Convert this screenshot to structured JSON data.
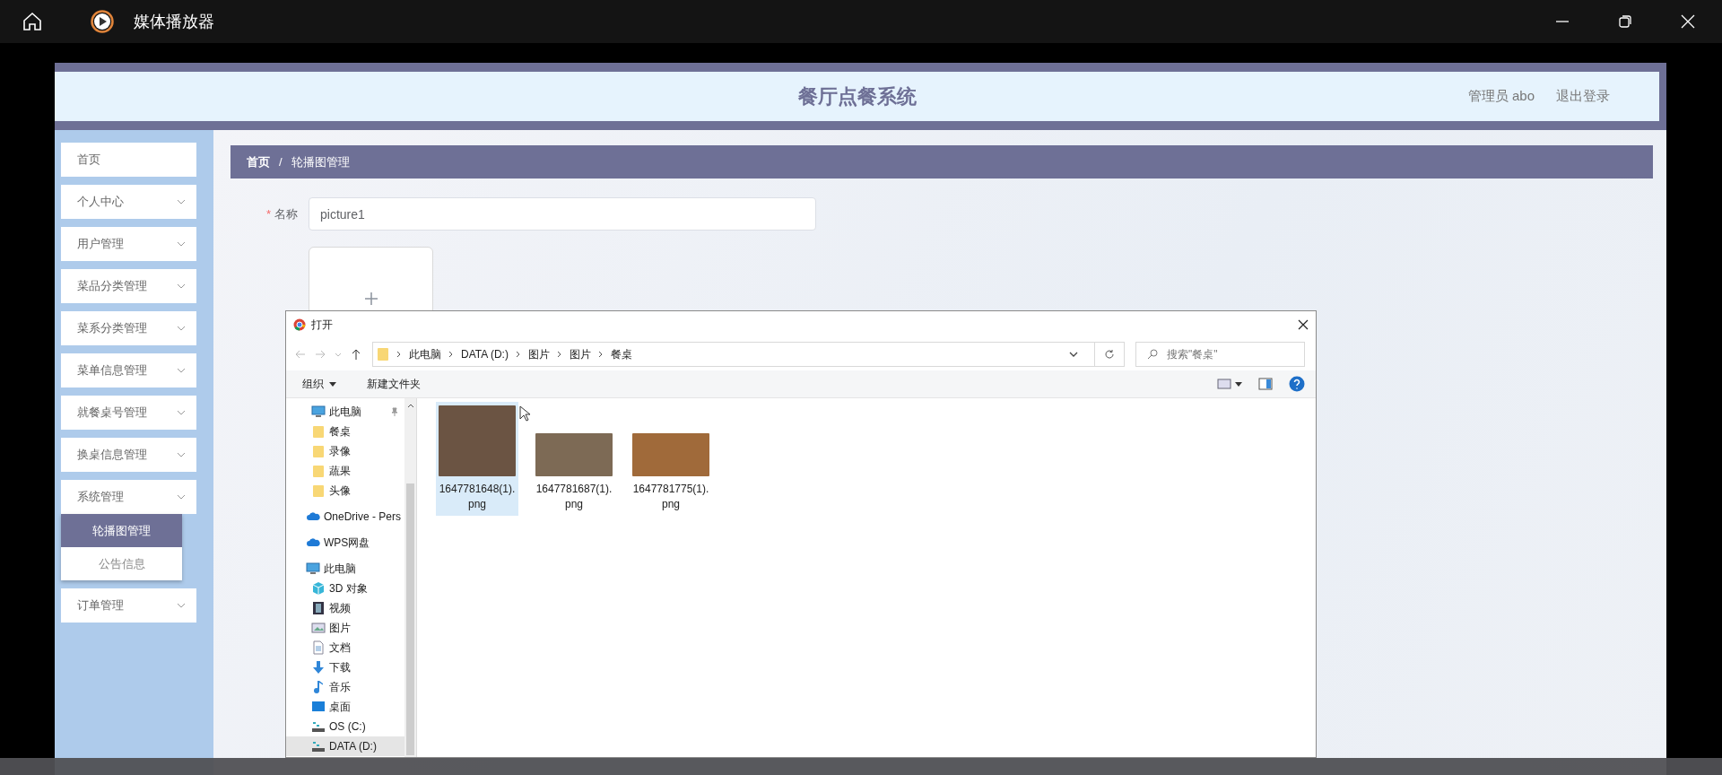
{
  "player": {
    "title": "媒体播放器"
  },
  "page": {
    "title": "餐厅点餐系统",
    "user": "管理员 abo",
    "logout": "退出登录"
  },
  "sidebar": {
    "items": [
      {
        "label": "首页",
        "kind": "link"
      },
      {
        "label": "个人中心",
        "kind": "group"
      },
      {
        "label": "用户管理",
        "kind": "group"
      },
      {
        "label": "菜品分类管理",
        "kind": "group"
      },
      {
        "label": "菜系分类管理",
        "kind": "group"
      },
      {
        "label": "菜单信息管理",
        "kind": "group"
      },
      {
        "label": "就餐桌号管理",
        "kind": "group"
      },
      {
        "label": "换桌信息管理",
        "kind": "group"
      },
      {
        "label": "系统管理",
        "kind": "group",
        "children": [
          {
            "label": "轮播图管理",
            "selected": true
          },
          {
            "label": "公告信息",
            "selected": false
          }
        ]
      },
      {
        "label": "订单管理",
        "kind": "group"
      }
    ]
  },
  "breadcrumb": {
    "items": [
      "首页",
      "轮播图管理"
    ],
    "separator": "/"
  },
  "form": {
    "required_mark": "*",
    "label": "名称",
    "value": "picture1"
  },
  "dialog": {
    "title": "打开",
    "path": [
      "此电脑",
      "DATA (D:)",
      "图片",
      "图片",
      "餐桌"
    ],
    "search_placeholder": "搜索\"餐桌\"",
    "toolbar": [
      {
        "label": "组织",
        "kind": "menu"
      },
      {
        "label": "新建文件夹",
        "kind": "button"
      }
    ],
    "nav": [
      {
        "label": "此电脑",
        "kind": "pc",
        "pinned": true,
        "selected": false,
        "children": [
          {
            "label": "餐桌",
            "kind": "folder",
            "selected": false
          },
          {
            "label": "录像",
            "kind": "folder",
            "selected": false
          },
          {
            "label": "蔬果",
            "kind": "folder",
            "selected": false
          },
          {
            "label": "头像",
            "kind": "folder",
            "selected": false
          }
        ]
      },
      {
        "label": "OneDrive - Pers",
        "kind": "cloud",
        "selected": false
      },
      {
        "label": "WPS网盘",
        "kind": "cloud",
        "selected": false
      },
      {
        "label": "此电脑",
        "kind": "pc",
        "selected": false,
        "children": [
          {
            "label": "3D 对象",
            "kind": "cube",
            "selected": false
          },
          {
            "label": "视频",
            "kind": "video",
            "selected": false
          },
          {
            "label": "图片",
            "kind": "picture",
            "selected": false
          },
          {
            "label": "文档",
            "kind": "document",
            "selected": false
          },
          {
            "label": "下载",
            "kind": "download",
            "selected": false
          },
          {
            "label": "音乐",
            "kind": "music",
            "selected": false
          },
          {
            "label": "桌面",
            "kind": "desktop",
            "selected": false
          },
          {
            "label": "OS (C:)",
            "kind": "drive",
            "selected": false
          },
          {
            "label": "DATA (D:)",
            "kind": "drive",
            "selected": true
          }
        ]
      }
    ],
    "files": [
      {
        "name": "1647781648(1).png",
        "selected": true
      },
      {
        "name": "1647781687(1).png",
        "selected": false
      },
      {
        "name": "1647781775(1).png",
        "selected": false
      }
    ]
  }
}
